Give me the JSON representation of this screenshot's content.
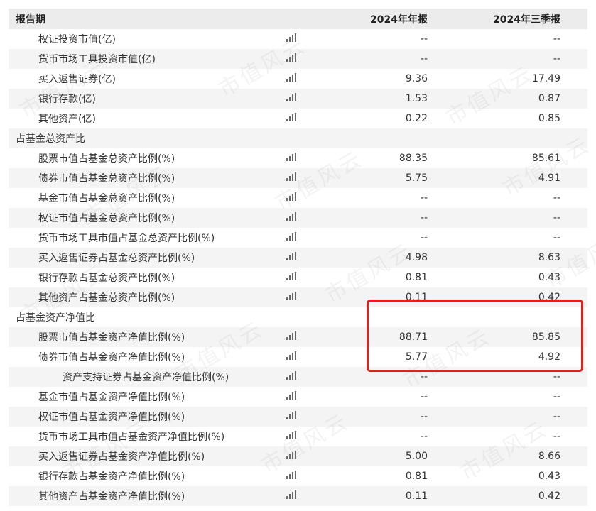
{
  "header": {
    "label": "报告期",
    "col_a": "2024年年报",
    "col_b": "2024年三季报"
  },
  "rows": [
    {
      "label": "权证投资市值(亿)",
      "a": "--",
      "b": "--"
    },
    {
      "label": "货币市场工具投资市值(亿)",
      "a": "--",
      "b": "--"
    },
    {
      "label": "买入返售证券(亿)",
      "a": "9.36",
      "b": "17.49"
    },
    {
      "label": "银行存款(亿)",
      "a": "1.53",
      "b": "0.87"
    },
    {
      "label": "其他资产(亿)",
      "a": "0.22",
      "b": "0.85"
    },
    {
      "label": "占基金总资产比",
      "a": "",
      "b": ""
    },
    {
      "label": "股票市值占基金总资产比例(%)",
      "a": "88.35",
      "b": "85.61"
    },
    {
      "label": "债券市值占基金总资产比例(%)",
      "a": "5.75",
      "b": "4.91"
    },
    {
      "label": "基金市值占基金总资产比例(%)",
      "a": "--",
      "b": "--"
    },
    {
      "label": "权证市值占基金总资产比例(%)",
      "a": "--",
      "b": "--"
    },
    {
      "label": "货币市场工具市值占基金总资产比例(%)",
      "a": "--",
      "b": "--"
    },
    {
      "label": "买入返售证券占基金总资产比例(%)",
      "a": "4.98",
      "b": "8.63"
    },
    {
      "label": "银行存款占基金总资产比例(%)",
      "a": "0.81",
      "b": "0.43"
    },
    {
      "label": "其他资产占基金总资产比例(%)",
      "a": "0.11",
      "b": "0.42"
    },
    {
      "label": "占基金资产净值比",
      "a": "",
      "b": ""
    },
    {
      "label": "股票市值占基金资产净值比例(%)",
      "a": "88.71",
      "b": "85.85"
    },
    {
      "label": "债券市值占基金资产净值比例(%)",
      "a": "5.77",
      "b": "4.92"
    },
    {
      "label": "资产支持证券占基金资产净值比例(%)",
      "a": "--",
      "b": "--"
    },
    {
      "label": "基金市值占基金资产净值比例(%)",
      "a": "--",
      "b": "--"
    },
    {
      "label": "权证市值占基金资产净值比例(%)",
      "a": "--",
      "b": "--"
    },
    {
      "label": "货币市场工具市值占基金资产净值比例(%)",
      "a": "--",
      "b": "--"
    },
    {
      "label": "买入返售证券占基金资产净值比例(%)",
      "a": "5.00",
      "b": "8.66"
    },
    {
      "label": "银行存款占基金资产净值比例(%)",
      "a": "0.81",
      "b": "0.43"
    },
    {
      "label": "其他资产占基金资产净值比例(%)",
      "a": "0.11",
      "b": "0.42"
    }
  ],
  "watermark_text": "市值风云",
  "icon": "bar-chart-icon",
  "colors": {
    "header_bg": "#ececec",
    "row_alt": "#f4f4f4",
    "highlight": "#e0211b",
    "icon": "#666666"
  }
}
